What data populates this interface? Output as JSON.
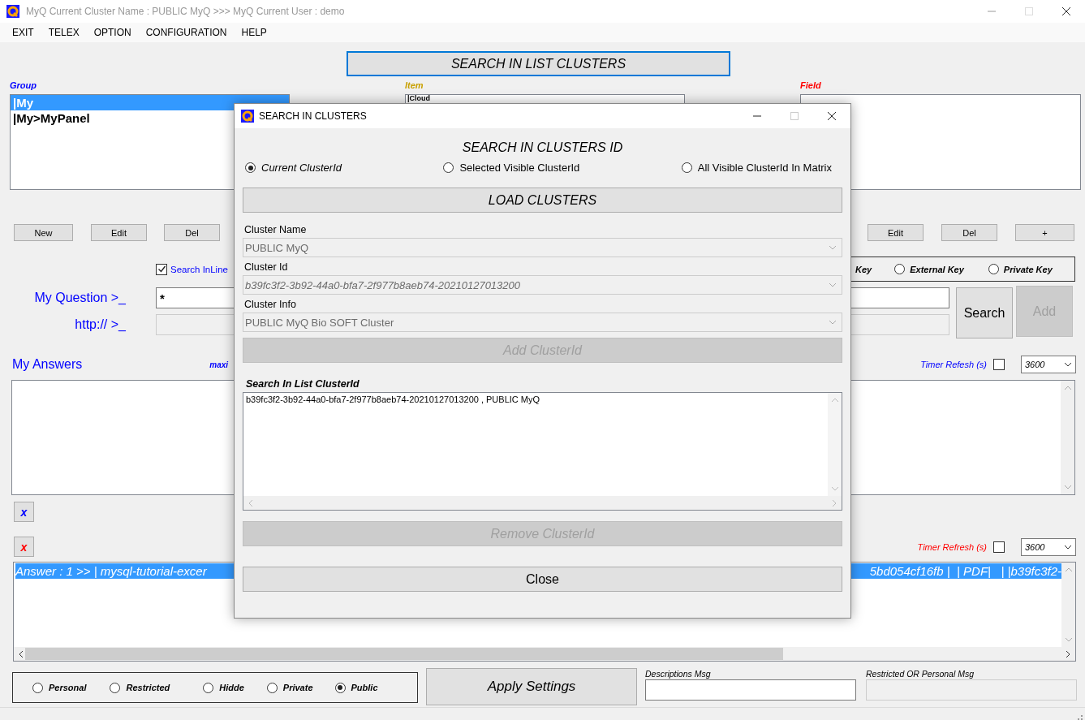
{
  "window": {
    "title": "MyQ Current Cluster Name : PUBLIC MyQ >>> MyQ Current User : demo"
  },
  "menu": [
    "EXIT",
    "TELEX",
    "OPTION",
    "CONFIGURATION",
    "HELP"
  ],
  "search_list_button": "SEARCH IN LIST CLUSTERS",
  "group": {
    "label": "Group",
    "items": [
      {
        "label": "|My",
        "selected": true
      },
      {
        "label": "|My>MyPanel",
        "selected": false
      }
    ],
    "buttons": [
      "New",
      "Edit",
      "Del"
    ]
  },
  "item": {
    "label": "Item",
    "value": "|Cloud"
  },
  "field": {
    "label": "Field",
    "buttons": [
      "Edit",
      "Del",
      "+"
    ]
  },
  "search_inline": {
    "label": "Search InLine",
    "checked": true
  },
  "key_option_cut": "Key",
  "key_options": [
    {
      "label": "External Key",
      "selected": false
    },
    {
      "label": "Private Key",
      "selected": false
    }
  ],
  "question": {
    "label": "My Question >_",
    "value": "*"
  },
  "url": {
    "label": "http:// >_",
    "disabled": true
  },
  "search_button": "Search",
  "add_button": {
    "label": "Add",
    "disabled": true
  },
  "answers": {
    "label": "My Answers",
    "cut_label": "maxi",
    "timer": {
      "label": "Timer Refesh (s)",
      "checked": false,
      "value": "3600"
    }
  },
  "clear_buttons": [
    {
      "label": "x",
      "color": "#0000ff"
    },
    {
      "label": "x",
      "color": "#ff0000"
    }
  ],
  "results": {
    "timer": {
      "label": "Timer Refresh (s)",
      "checked": false,
      "value": "3600"
    },
    "rows": [
      {
        "text_start": "Answer : 1 >> | mysql-tutorial-excer",
        "text_end": "5bd054cf16fb |  | PDF|   | |b39fc3f2-",
        "selected": true
      }
    ]
  },
  "visibility": [
    {
      "label": "Personal",
      "selected": false
    },
    {
      "label": "Restricted",
      "selected": false
    },
    {
      "label": "Hidde",
      "selected": false
    },
    {
      "label": "Private",
      "selected": false
    },
    {
      "label": "Public",
      "selected": true
    }
  ],
  "apply_button": "Apply Settings",
  "descriptions_msg": {
    "label": "Descriptions Msg",
    "disabled": false
  },
  "restricted_msg": {
    "label": "Restricted OR Personal Msg",
    "disabled": true
  },
  "dialog": {
    "title": "SEARCH IN CLUSTERS",
    "heading": "SEARCH IN CLUSTERS ID",
    "scope": [
      {
        "label": "Current ClusterId",
        "selected": true
      },
      {
        "label": "Selected Visible ClusterId",
        "selected": false
      },
      {
        "label": "All Visible ClusterId In Matrix",
        "selected": false
      }
    ],
    "load_button": "LOAD CLUSTERS",
    "fields": [
      {
        "label": "Cluster Name",
        "value": "PUBLIC MyQ",
        "italic": false,
        "disabled": true
      },
      {
        "label": "Cluster Id",
        "value": "b39fc3f2-3b92-44a0-bfa7-2f977b8aeb74-20210127013200",
        "italic": true,
        "disabled": true
      },
      {
        "label": "Cluster Info",
        "value": "PUBLIC MyQ Bio SOFT Cluster",
        "italic": false,
        "disabled": true
      }
    ],
    "add_button": {
      "label": "Add ClusterId",
      "disabled": true
    },
    "list_label": "Search In List ClusterId",
    "list_items": [
      "b39fc3f2-3b92-44a0-bfa7-2f977b8aeb74-20210127013200 , PUBLIC MyQ"
    ],
    "remove_button": {
      "label": "Remove ClusterId",
      "disabled": true
    },
    "close_button": "Close"
  }
}
